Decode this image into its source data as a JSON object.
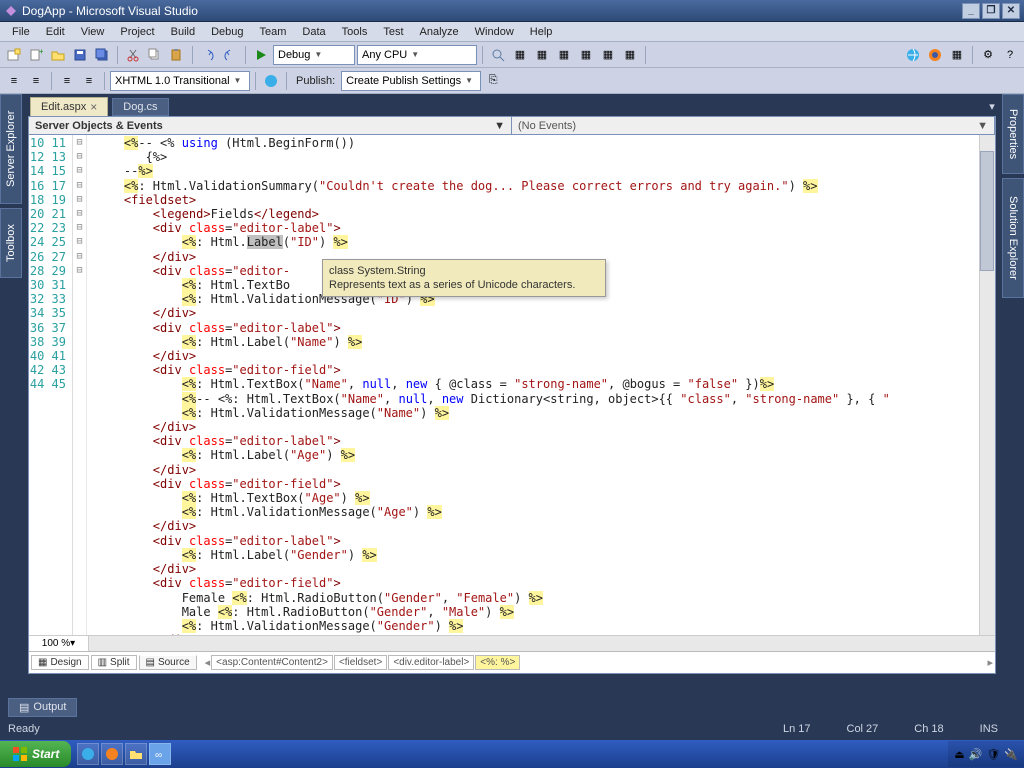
{
  "title": "DogApp - Microsoft Visual Studio",
  "menu": [
    "File",
    "Edit",
    "View",
    "Project",
    "Build",
    "Debug",
    "Team",
    "Data",
    "Tools",
    "Test",
    "Analyze",
    "Window",
    "Help"
  ],
  "toolbar1": {
    "config_combo": "Debug",
    "platform_combo": "Any CPU"
  },
  "toolbar2": {
    "doctype_combo": "XHTML 1.0 Transitional",
    "publish_label": "Publish:",
    "publish_combo": "Create Publish Settings"
  },
  "left_tabs": [
    "Server Explorer",
    "Toolbox"
  ],
  "right_tabs": [
    "Properties",
    "Solution Explorer"
  ],
  "tabs": [
    {
      "label": "Edit.aspx",
      "active": true
    },
    {
      "label": "Dog.cs",
      "active": false
    }
  ],
  "editor_head": {
    "left": "Server Objects & Events",
    "right": "(No Events)"
  },
  "line_start": 10,
  "line_end": 45,
  "fold_markers": {
    "10": "⊟",
    "14": "⊟",
    "16": "⊟",
    "19": "⊟",
    "23": "⊟",
    "26": "⊟",
    "31": "⊟",
    "34": "⊟",
    "38": "⊟",
    "41": "⊟"
  },
  "tooltip": {
    "line1": "class System.String",
    "line2": "Represents text as a series of Unicode characters."
  },
  "zoom": "100 %",
  "view_tabs": [
    "Design",
    "Split",
    "Source"
  ],
  "view_active": 2,
  "breadcrumbs": [
    "<asp:Content#Content2>",
    "<fieldset>",
    "<div.editor-label>",
    "<%: %>"
  ],
  "output_tab": "Output",
  "status": {
    "ready": "Ready",
    "ln": "Ln 17",
    "col": "Col 27",
    "ch": "Ch 18",
    "ins": "INS"
  },
  "start": "Start"
}
